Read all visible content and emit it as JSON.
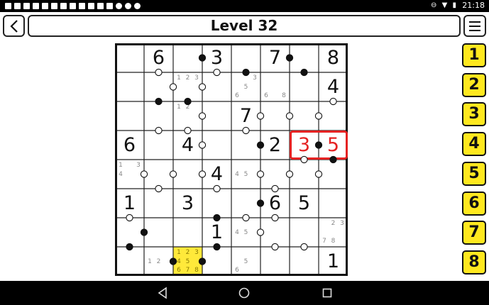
{
  "status_bar": {
    "time": "21:18",
    "left_icons": [
      "notification-icon",
      "notification-icon",
      "notification-icon",
      "notification-icon",
      "notification-icon",
      "notification-icon",
      "notification-icon",
      "notification-icon",
      "mail-icon",
      "mail-icon",
      "media-icon",
      "bug-icon",
      "circle-icon",
      "circle-icon",
      "circle-icon"
    ],
    "right_icons": [
      "minus-circle-icon",
      "wifi-icon",
      "battery-icon"
    ]
  },
  "header": {
    "title": "Level 32",
    "back_icon": "chevron-left-icon",
    "menu_icon": "hamburger-menu-icon"
  },
  "board": {
    "size": 8,
    "cells": [
      [
        {
          "v": ""
        },
        {
          "v": "6"
        },
        {
          "v": ""
        },
        {
          "v": "3"
        },
        {
          "v": ""
        },
        {
          "v": "7"
        },
        {
          "v": ""
        },
        {
          "v": "8"
        }
      ],
      [
        {
          "v": ""
        },
        {
          "v": ""
        },
        {
          "c": [
            "1",
            "2",
            "3"
          ]
        },
        {
          "v": ""
        },
        {
          "c": [
            "",
            "",
            "3",
            "",
            "5",
            "",
            "6"
          ]
        },
        {
          "c": [
            "",
            "",
            "",
            "",
            "",
            "",
            "6",
            "",
            "8"
          ]
        },
        {
          "v": ""
        },
        {
          "v": "4"
        }
      ],
      [
        {
          "v": ""
        },
        {
          "v": ""
        },
        {
          "c": [
            "1",
            "2"
          ]
        },
        {
          "v": ""
        },
        {
          "v": "7"
        },
        {
          "v": ""
        },
        {
          "v": ""
        },
        {
          "v": ""
        }
      ],
      [
        {
          "v": "6"
        },
        {
          "v": ""
        },
        {
          "v": "4"
        },
        {
          "v": ""
        },
        {
          "v": ""
        },
        {
          "v": "2"
        },
        {
          "v": "3",
          "red": true
        },
        {
          "v": "5",
          "red": true
        }
      ],
      [
        {
          "c": [
            "1",
            "",
            "3",
            "4"
          ]
        },
        {
          "v": ""
        },
        {
          "v": ""
        },
        {
          "v": "4"
        },
        {
          "c": [
            "",
            "",
            "",
            "4",
            "5"
          ]
        },
        {
          "v": ""
        },
        {
          "v": ""
        },
        {
          "v": ""
        }
      ],
      [
        {
          "v": "1"
        },
        {
          "v": ""
        },
        {
          "v": "3"
        },
        {
          "v": ""
        },
        {
          "v": ""
        },
        {
          "v": "6"
        },
        {
          "v": "5"
        },
        {
          "v": ""
        }
      ],
      [
        {
          "v": ""
        },
        {
          "v": ""
        },
        {
          "v": ""
        },
        {
          "v": "1"
        },
        {
          "c": [
            "",
            "",
            "",
            "4",
            "5"
          ]
        },
        {
          "v": ""
        },
        {
          "v": ""
        },
        {
          "c": [
            "",
            "2",
            "3",
            "",
            "",
            "",
            "7",
            "8"
          ]
        }
      ],
      [
        {
          "v": ""
        },
        {
          "c": [
            "",
            "",
            "",
            "1",
            "2"
          ]
        },
        {
          "c": [
            "1",
            "2",
            "3",
            "4",
            "5",
            "",
            "6",
            "7",
            "8"
          ],
          "hl": true
        },
        {
          "v": ""
        },
        {
          "c": [
            "",
            "",
            "",
            "",
            "5",
            "",
            "6"
          ]
        },
        {
          "v": ""
        },
        {
          "v": ""
        },
        {
          "v": "1"
        }
      ]
    ],
    "selection_box": {
      "row": 3,
      "col_start": 6,
      "col_end": 7,
      "color": "#e52222"
    },
    "highlight_color": "#ffe93a",
    "dots": [
      {
        "r": 0,
        "c": 2,
        "dir": "right",
        "type": "black"
      },
      {
        "r": 0,
        "c": 3,
        "dir": "down",
        "type": "white"
      },
      {
        "r": 0,
        "c": 4,
        "dir": "down",
        "type": "black"
      },
      {
        "r": 0,
        "c": 5,
        "dir": "right",
        "type": "black"
      },
      {
        "r": 0,
        "c": 6,
        "dir": "down",
        "type": "black"
      },
      {
        "r": 0,
        "c": 1,
        "dir": "down",
        "type": "white"
      },
      {
        "r": 1,
        "c": 1,
        "dir": "right",
        "type": "white"
      },
      {
        "r": 1,
        "c": 2,
        "dir": "right",
        "type": "white"
      },
      {
        "r": 1,
        "c": 7,
        "dir": "down",
        "type": "white"
      },
      {
        "r": 1,
        "c": 1,
        "dir": "down",
        "type": "black"
      },
      {
        "r": 1,
        "c": 2,
        "dir": "down",
        "type": "black"
      },
      {
        "r": 2,
        "c": 2,
        "dir": "right",
        "type": "white"
      },
      {
        "r": 2,
        "c": 4,
        "dir": "right",
        "type": "white"
      },
      {
        "r": 2,
        "c": 5,
        "dir": "right",
        "type": "white"
      },
      {
        "r": 2,
        "c": 6,
        "dir": "right",
        "type": "white"
      },
      {
        "r": 2,
        "c": 1,
        "dir": "down",
        "type": "white"
      },
      {
        "r": 2,
        "c": 4,
        "dir": "down",
        "type": "white"
      },
      {
        "r": 3,
        "c": 2,
        "dir": "right",
        "type": "white"
      },
      {
        "r": 3,
        "c": 4,
        "dir": "right",
        "type": "black"
      },
      {
        "r": 3,
        "c": 6,
        "dir": "right",
        "type": "black"
      },
      {
        "r": 3,
        "c": 2,
        "dir": "up",
        "type": "white"
      },
      {
        "r": 3,
        "c": 6,
        "dir": "down",
        "type": "white"
      },
      {
        "r": 3,
        "c": 7,
        "dir": "down",
        "type": "black"
      },
      {
        "r": 4,
        "c": 0,
        "dir": "right",
        "type": "white"
      },
      {
        "r": 4,
        "c": 1,
        "dir": "right",
        "type": "white"
      },
      {
        "r": 4,
        "c": 2,
        "dir": "right",
        "type": "white"
      },
      {
        "r": 4,
        "c": 4,
        "dir": "right",
        "type": "white"
      },
      {
        "r": 4,
        "c": 5,
        "dir": "right",
        "type": "white"
      },
      {
        "r": 4,
        "c": 6,
        "dir": "right",
        "type": "white"
      },
      {
        "r": 4,
        "c": 1,
        "dir": "down",
        "type": "white"
      },
      {
        "r": 4,
        "c": 3,
        "dir": "down",
        "type": "white"
      },
      {
        "r": 4,
        "c": 5,
        "dir": "down",
        "type": "white"
      },
      {
        "r": 5,
        "c": 4,
        "dir": "right",
        "type": "black"
      },
      {
        "r": 5,
        "c": 0,
        "dir": "down",
        "type": "white"
      },
      {
        "r": 5,
        "c": 3,
        "dir": "down",
        "type": "black"
      },
      {
        "r": 5,
        "c": 4,
        "dir": "down",
        "type": "white"
      },
      {
        "r": 5,
        "c": 5,
        "dir": "down",
        "type": "white"
      },
      {
        "r": 6,
        "c": 0,
        "dir": "right",
        "type": "black"
      },
      {
        "r": 6,
        "c": 4,
        "dir": "right",
        "type": "white"
      },
      {
        "r": 6,
        "c": 0,
        "dir": "down",
        "type": "black"
      },
      {
        "r": 6,
        "c": 3,
        "dir": "down",
        "type": "black"
      },
      {
        "r": 6,
        "c": 5,
        "dir": "down",
        "type": "white"
      },
      {
        "r": 6,
        "c": 6,
        "dir": "down",
        "type": "white"
      },
      {
        "r": 7,
        "c": 1,
        "dir": "right",
        "type": "black"
      },
      {
        "r": 7,
        "c": 2,
        "dir": "right",
        "type": "black"
      }
    ]
  },
  "number_pad": [
    "1",
    "2",
    "3",
    "4",
    "5",
    "6",
    "7",
    "8"
  ],
  "nav_bar": {
    "back_icon": "triangle-back-icon",
    "home_icon": "circle-home-icon",
    "recents_icon": "square-recents-icon"
  }
}
